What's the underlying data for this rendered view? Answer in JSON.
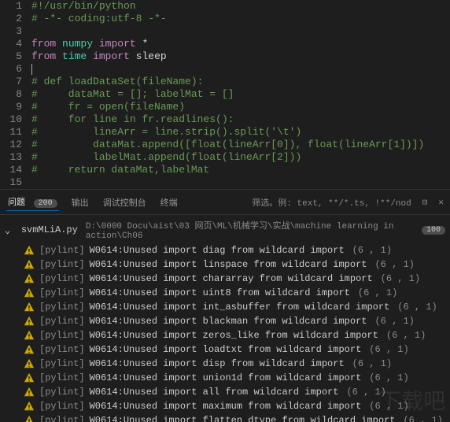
{
  "editor": {
    "lines": [
      {
        "n": 1,
        "segments": [
          {
            "cls": "tok-comment",
            "t": "#!/usr/bin/python"
          }
        ]
      },
      {
        "n": 2,
        "segments": [
          {
            "cls": "tok-comment",
            "t": "# -*- coding:utf-8 -*-"
          }
        ]
      },
      {
        "n": 3,
        "segments": []
      },
      {
        "n": 4,
        "segments": [
          {
            "cls": "tok-keyword",
            "t": "from"
          },
          {
            "cls": "tok-op",
            "t": " "
          },
          {
            "cls": "tok-module",
            "t": "numpy"
          },
          {
            "cls": "tok-op",
            "t": " "
          },
          {
            "cls": "tok-keyword",
            "t": "import"
          },
          {
            "cls": "tok-op",
            "t": " *"
          }
        ]
      },
      {
        "n": 5,
        "segments": [
          {
            "cls": "tok-keyword",
            "t": "from"
          },
          {
            "cls": "tok-op",
            "t": " "
          },
          {
            "cls": "tok-module",
            "t": "time"
          },
          {
            "cls": "tok-op",
            "t": " "
          },
          {
            "cls": "tok-keyword",
            "t": "import"
          },
          {
            "cls": "tok-op",
            "t": " sleep"
          }
        ]
      },
      {
        "n": 6,
        "segments": [],
        "cursor": true
      },
      {
        "n": 7,
        "segments": [
          {
            "cls": "tok-comment",
            "t": "# def loadDataSet(fileName):"
          }
        ]
      },
      {
        "n": 8,
        "segments": [
          {
            "cls": "tok-comment",
            "t": "#     dataMat = []; labelMat = []"
          }
        ]
      },
      {
        "n": 9,
        "segments": [
          {
            "cls": "tok-comment",
            "t": "#     fr = open(fileName)"
          }
        ]
      },
      {
        "n": 10,
        "segments": [
          {
            "cls": "tok-comment",
            "t": "#     for line in fr.readlines():"
          }
        ]
      },
      {
        "n": 11,
        "segments": [
          {
            "cls": "tok-comment",
            "t": "#         lineArr = line.strip().split('\\t')"
          }
        ]
      },
      {
        "n": 12,
        "segments": [
          {
            "cls": "tok-comment",
            "t": "#         dataMat.append([float(lineArr[0]), float(lineArr[1])])"
          }
        ]
      },
      {
        "n": 13,
        "segments": [
          {
            "cls": "tok-comment",
            "t": "#         labelMat.append(float(lineArr[2]))"
          }
        ]
      },
      {
        "n": 14,
        "segments": [
          {
            "cls": "tok-comment",
            "t": "#     return dataMat,labelMat"
          }
        ]
      },
      {
        "n": 15,
        "segments": []
      }
    ]
  },
  "panel": {
    "tabs": {
      "problems": "问题",
      "problems_badge": "200",
      "output": "输出",
      "debug": "调试控制台",
      "terminal": "终端"
    },
    "filter_placeholder": "筛选。例: text, **/*.ts, !**/nod",
    "file": {
      "name": "svmMLiA.py",
      "path": "D:\\0000  Docu\\aist\\03 网页\\ML\\机械学习\\实战\\machine learning in action\\Ch06",
      "count": "100"
    },
    "problems": [
      {
        "src": "[pylint]",
        "msg": "W0614:Unused import diag from wildcard import",
        "loc": "(6 , 1)"
      },
      {
        "src": "[pylint]",
        "msg": "W0614:Unused import linspace from wildcard import",
        "loc": "(6 , 1)"
      },
      {
        "src": "[pylint]",
        "msg": "W0614:Unused import chararray from wildcard import",
        "loc": "(6 , 1)"
      },
      {
        "src": "[pylint]",
        "msg": "W0614:Unused import uint8 from wildcard import",
        "loc": "(6 , 1)"
      },
      {
        "src": "[pylint]",
        "msg": "W0614:Unused import int_asbuffer from wildcard import",
        "loc": "(6 , 1)"
      },
      {
        "src": "[pylint]",
        "msg": "W0614:Unused import blackman from wildcard import",
        "loc": "(6 , 1)"
      },
      {
        "src": "[pylint]",
        "msg": "W0614:Unused import zeros_like from wildcard import",
        "loc": "(6 , 1)"
      },
      {
        "src": "[pylint]",
        "msg": "W0614:Unused import loadtxt from wildcard import",
        "loc": "(6 , 1)"
      },
      {
        "src": "[pylint]",
        "msg": "W0614:Unused import disp from wildcard import",
        "loc": "(6 , 1)"
      },
      {
        "src": "[pylint]",
        "msg": "W0614:Unused import union1d from wildcard import",
        "loc": "(6 , 1)"
      },
      {
        "src": "[pylint]",
        "msg": "W0614:Unused import all from wildcard import",
        "loc": "(6 , 1)"
      },
      {
        "src": "[pylint]",
        "msg": "W0614:Unused import maximum from wildcard import",
        "loc": "(6 , 1)"
      },
      {
        "src": "[pylint]",
        "msg": "W0614:Unused import flatten_dtype from wildcard import",
        "loc": "(6 , 1)"
      }
    ]
  },
  "watermark": "下载吧"
}
